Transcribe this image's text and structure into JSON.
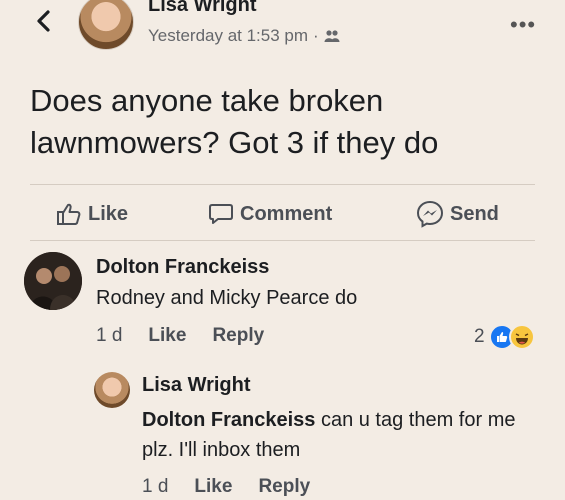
{
  "post": {
    "author": "Lisa Wright",
    "timestamp": "Yesterday at 1:53 pm",
    "separator": "·",
    "audience_icon": "friends-icon",
    "more_label": "•••",
    "text": "Does anyone take broken lawnmowers? Got 3 if they do"
  },
  "actions": {
    "like_label": "Like",
    "comment_label": "Comment",
    "send_label": "Send"
  },
  "comment": {
    "author": "Dolton Franckeiss",
    "text": "Rodney and Micky Pearce do",
    "time": "1 d",
    "like_label": "Like",
    "reply_label": "Reply",
    "reaction_count": "2"
  },
  "reply": {
    "author": "Lisa Wright",
    "tag": "Dolton Franckeiss",
    "text": " can u tag them for me plz. I'll inbox them",
    "time": "1 d",
    "like_label": "Like",
    "reply_label": "Reply"
  },
  "colors": {
    "background": "#f3ece4",
    "like_blue": "#1877f2",
    "haha_yellow": "#f7c53e",
    "meta_grey": "#65676b"
  }
}
